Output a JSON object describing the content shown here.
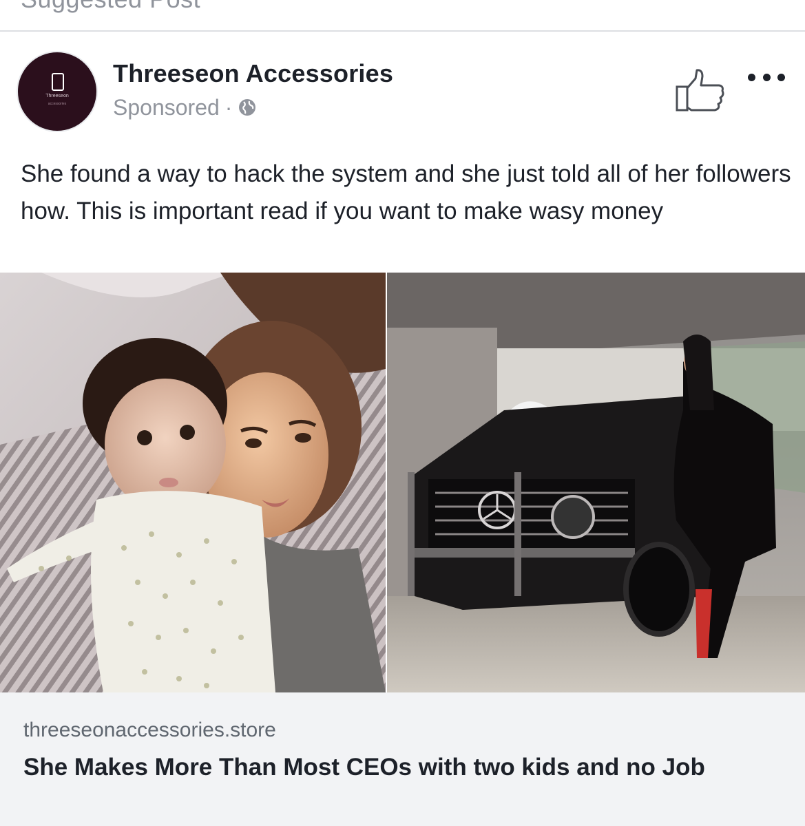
{
  "section": {
    "header": "Suggested Post"
  },
  "post": {
    "page_name": "Threeseon Accessories",
    "sponsored_label": "Sponsored",
    "separator": "·",
    "audience_icon": "globe-icon",
    "like_icon": "thumbs-up-icon",
    "more_icon": "ellipsis-icon",
    "avatar": {
      "brand_text": "Threeseon",
      "sub_text": "accessories",
      "color": "#2b0f1c"
    },
    "text": "She found a way to hack the system and she just told all of her followers how. This is important read if you want to make wasy money",
    "images": [
      {
        "name": "woman-with-baby-photo"
      },
      {
        "name": "woman-with-suv-photo"
      }
    ]
  },
  "link": {
    "domain": "threeseonaccessories.store",
    "title": "She Makes More Than Most CEOs with two kids and no Job"
  },
  "colors": {
    "text_primary": "#1d2129",
    "text_secondary": "#90949c",
    "link_background": "#f2f3f5",
    "divider": "#dddfe2"
  }
}
